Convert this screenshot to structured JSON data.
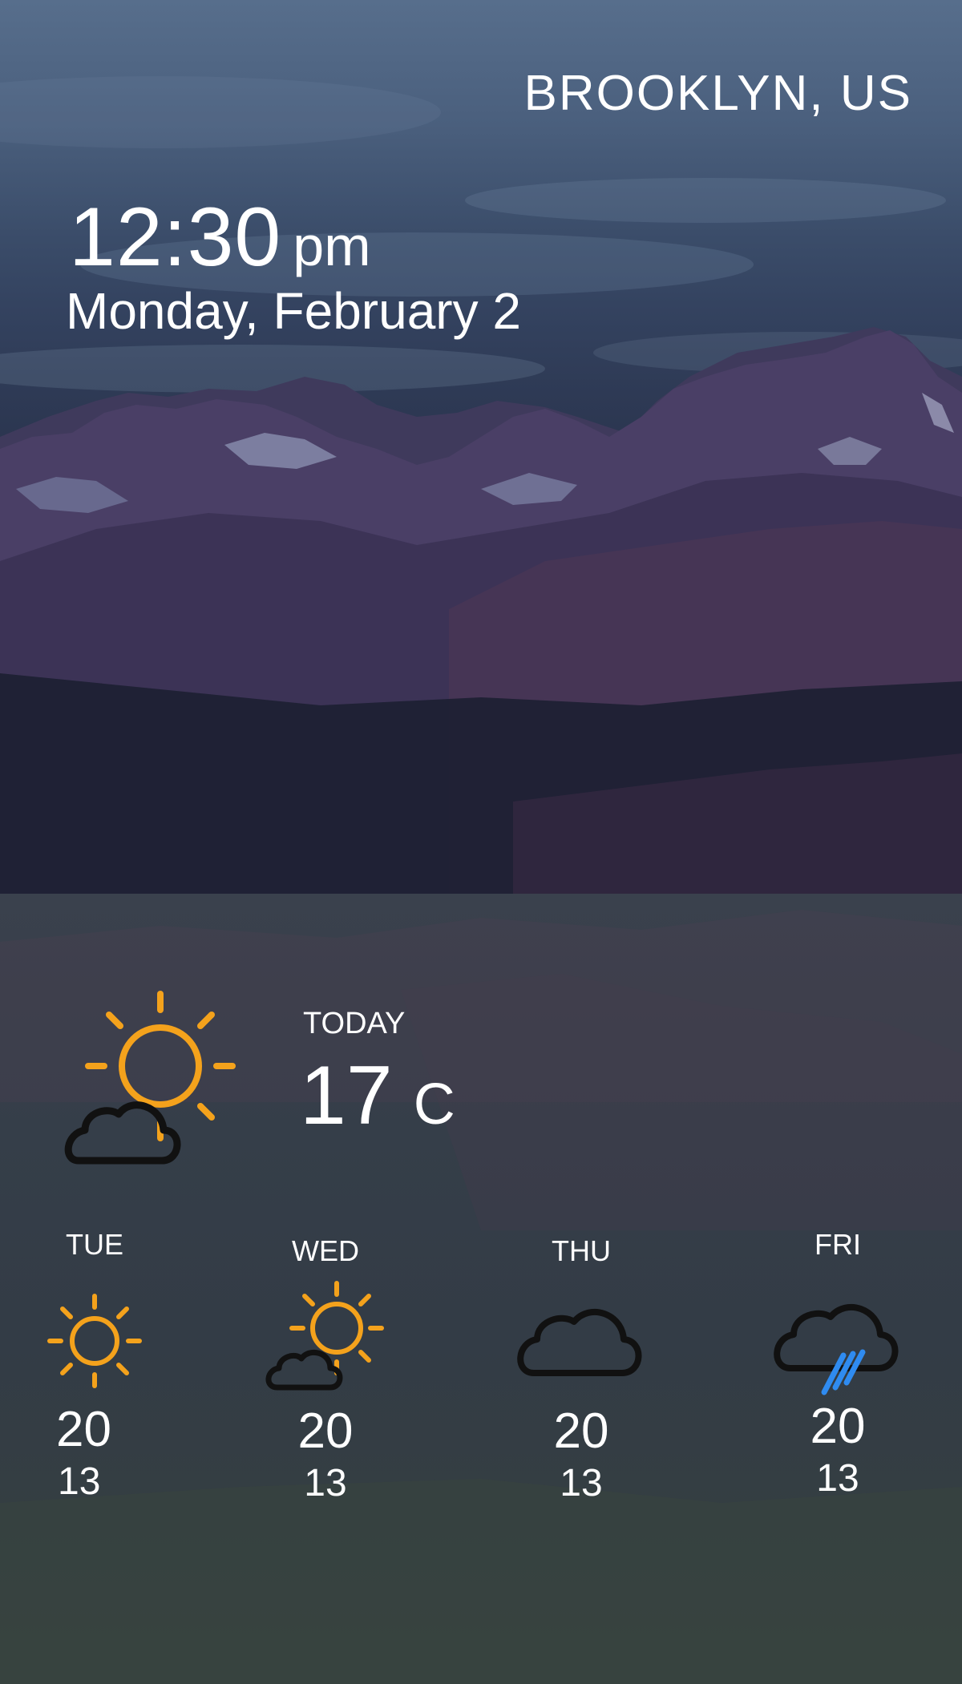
{
  "header": {
    "location": "BROOKLYN, US",
    "time": "12:30",
    "ampm": "pm",
    "date": "Monday, February 2"
  },
  "today": {
    "label": "TODAY",
    "temp": "17",
    "unit": "C",
    "icon": "partly-cloudy-icon"
  },
  "forecast": [
    {
      "day": "TUE",
      "high": "20",
      "low": "13",
      "icon": "sun-icon"
    },
    {
      "day": "WED",
      "high": "20",
      "low": "13",
      "icon": "partly-cloudy-icon"
    },
    {
      "day": "THU",
      "high": "20",
      "low": "13",
      "icon": "cloud-icon"
    },
    {
      "day": "FRI",
      "high": "20",
      "low": "13",
      "icon": "rain-icon"
    }
  ],
  "colors": {
    "sun": "#f4a21c",
    "cloud_outline": "#111111",
    "rain": "#2f8bf0",
    "text": "#ffffff"
  }
}
